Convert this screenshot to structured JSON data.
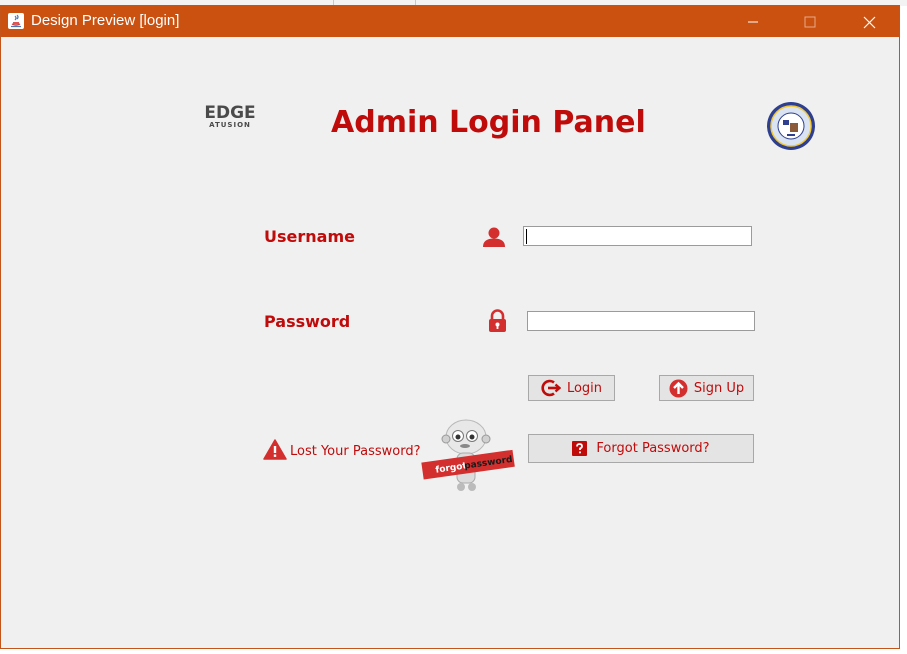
{
  "window": {
    "title": "Design Preview [login]",
    "accent_color": "#ca5110"
  },
  "header": {
    "logo_text": "EDGE",
    "logo_subtext": "ATUSION",
    "title": "Admin Login Panel",
    "title_color": "#c00b0b",
    "seal_icon": "university-seal-icon"
  },
  "form": {
    "username_label": "Username",
    "username_icon": "user-icon",
    "username_value": "",
    "password_label": "Password",
    "password_icon": "lock-icon",
    "password_value": ""
  },
  "buttons": {
    "login_label": "Login",
    "login_icon": "login-arrow-icon",
    "signup_label": "Sign Up",
    "signup_icon": "up-arrow-circle-icon",
    "forgot_label": "Forgot Password?",
    "forgot_icon": "question-icon"
  },
  "links": {
    "lost_password": "Lost Your Password?",
    "lost_password_icon": "warning-icon"
  },
  "mascot": {
    "sign_text_1": "forgot",
    "sign_text_2": "password",
    "icon": "robot-mascot-icon"
  }
}
